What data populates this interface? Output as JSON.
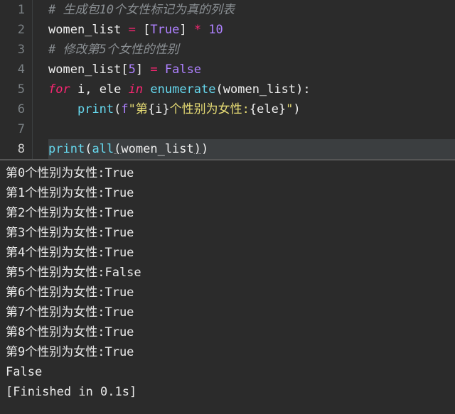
{
  "editor": {
    "line_numbers": [
      "1",
      "2",
      "3",
      "4",
      "5",
      "6",
      "7",
      "8"
    ],
    "current_line_index": 7,
    "lines": [
      {
        "tokens": [
          {
            "cls": "tok-comment",
            "t": "# 生成包10个女性标记为真的列表"
          }
        ]
      },
      {
        "tokens": [
          {
            "cls": "tok-ident",
            "t": "women_list"
          },
          {
            "cls": "tok-ident",
            "t": " "
          },
          {
            "cls": "tok-op",
            "t": "="
          },
          {
            "cls": "tok-ident",
            "t": " "
          },
          {
            "cls": "tok-punc",
            "t": "["
          },
          {
            "cls": "tok-const",
            "t": "True"
          },
          {
            "cls": "tok-punc",
            "t": "]"
          },
          {
            "cls": "tok-ident",
            "t": " "
          },
          {
            "cls": "tok-op",
            "t": "*"
          },
          {
            "cls": "tok-ident",
            "t": " "
          },
          {
            "cls": "tok-num",
            "t": "10"
          }
        ]
      },
      {
        "tokens": [
          {
            "cls": "tok-comment",
            "t": "# 修改第5个女性的性别"
          }
        ]
      },
      {
        "tokens": [
          {
            "cls": "tok-ident",
            "t": "women_list"
          },
          {
            "cls": "tok-punc",
            "t": "["
          },
          {
            "cls": "tok-num",
            "t": "5"
          },
          {
            "cls": "tok-punc",
            "t": "]"
          },
          {
            "cls": "tok-ident",
            "t": " "
          },
          {
            "cls": "tok-op",
            "t": "="
          },
          {
            "cls": "tok-ident",
            "t": " "
          },
          {
            "cls": "tok-const",
            "t": "False"
          }
        ]
      },
      {
        "tokens": [
          {
            "cls": "tok-kw",
            "t": "for"
          },
          {
            "cls": "tok-ident",
            "t": " i"
          },
          {
            "cls": "tok-punc",
            "t": ","
          },
          {
            "cls": "tok-ident",
            "t": " ele "
          },
          {
            "cls": "tok-kw",
            "t": "in"
          },
          {
            "cls": "tok-ident",
            "t": " "
          },
          {
            "cls": "tok-func",
            "t": "enumerate"
          },
          {
            "cls": "tok-punc",
            "t": "("
          },
          {
            "cls": "tok-ident",
            "t": "women_list"
          },
          {
            "cls": "tok-punc",
            "t": ")"
          },
          {
            "cls": "tok-punc",
            "t": ":"
          }
        ]
      },
      {
        "indent": "    ",
        "tokens": [
          {
            "cls": "tok-func",
            "t": "print"
          },
          {
            "cls": "tok-punc",
            "t": "("
          },
          {
            "cls": "tok-fprefix",
            "t": "f"
          },
          {
            "cls": "tok-str",
            "t": "\"第"
          },
          {
            "cls": "tok-punc",
            "t": "{"
          },
          {
            "cls": "tok-ident",
            "t": "i"
          },
          {
            "cls": "tok-punc",
            "t": "}"
          },
          {
            "cls": "tok-str",
            "t": "个性别为女性:"
          },
          {
            "cls": "tok-punc",
            "t": "{"
          },
          {
            "cls": "tok-ident",
            "t": "ele"
          },
          {
            "cls": "tok-punc",
            "t": "}"
          },
          {
            "cls": "tok-str",
            "t": "\""
          },
          {
            "cls": "tok-punc",
            "t": ")"
          }
        ]
      },
      {
        "tokens": []
      },
      {
        "current": true,
        "tokens": [
          {
            "cls": "tok-func",
            "t": "print"
          },
          {
            "cls": "tok-punc",
            "t": "("
          },
          {
            "cls": "tok-func",
            "t": "all"
          },
          {
            "cls": "tok-punc tok-underline",
            "t": "("
          },
          {
            "cls": "tok-ident",
            "t": "women_list"
          },
          {
            "cls": "tok-punc tok-underline",
            "t": ")"
          },
          {
            "cls": "tok-punc",
            "t": ")"
          }
        ]
      }
    ]
  },
  "output": {
    "lines": [
      "第0个性别为女性:True",
      "第1个性别为女性:True",
      "第2个性别为女性:True",
      "第3个性别为女性:True",
      "第4个性别为女性:True",
      "第5个性别为女性:False",
      "第6个性别为女性:True",
      "第7个性别为女性:True",
      "第8个性别为女性:True",
      "第9个性别为女性:True",
      "False",
      "[Finished in 0.1s]"
    ]
  }
}
